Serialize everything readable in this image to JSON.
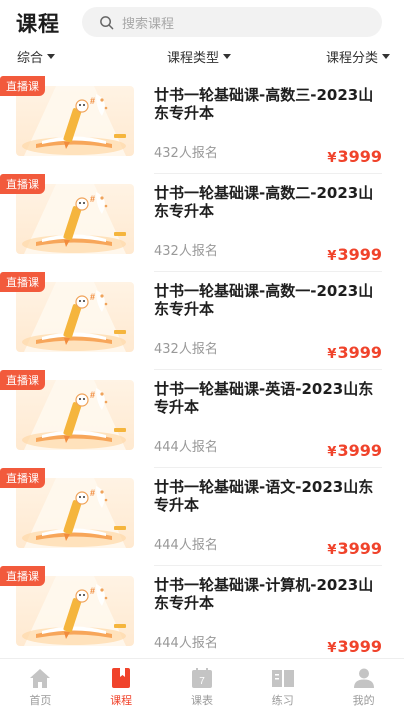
{
  "header": {
    "title": "课程",
    "search_placeholder": "搜索课程"
  },
  "filters": [
    {
      "label": "综合"
    },
    {
      "label": "课程类型"
    },
    {
      "label": "课程分类"
    }
  ],
  "courses": [
    {
      "tag": "直播课",
      "title": "廿书一轮基础课-高数三-2023山东专升本",
      "enrolled": "432人报名",
      "currency": "¥",
      "price": "3999"
    },
    {
      "tag": "直播课",
      "title": "廿书一轮基础课-高数二-2023山东专升本",
      "enrolled": "432人报名",
      "currency": "¥",
      "price": "3999"
    },
    {
      "tag": "直播课",
      "title": "廿书一轮基础课-高数一-2023山东专升本",
      "enrolled": "432人报名",
      "currency": "¥",
      "price": "3999"
    },
    {
      "tag": "直播课",
      "title": "廿书一轮基础课-英语-2023山东专升本",
      "enrolled": "444人报名",
      "currency": "¥",
      "price": "3999"
    },
    {
      "tag": "直播课",
      "title": "廿书一轮基础课-语文-2023山东专升本",
      "enrolled": "444人报名",
      "currency": "¥",
      "price": "3999"
    },
    {
      "tag": "直播课",
      "title": "廿书一轮基础课-计算机-2023山东专升本",
      "enrolled": "444人报名",
      "currency": "¥",
      "price": "3999"
    }
  ],
  "tabbar": [
    {
      "label": "首页",
      "icon": "home-icon",
      "active": false
    },
    {
      "label": "课程",
      "icon": "bookmark-book-icon",
      "active": true
    },
    {
      "label": "课表",
      "icon": "calendar-icon",
      "calendar_day": "7",
      "active": false
    },
    {
      "label": "练习",
      "icon": "open-book-icon",
      "active": false
    },
    {
      "label": "我的",
      "icon": "user-icon",
      "active": false
    }
  ],
  "colors": {
    "accent": "#f0432b",
    "tag": "#f25a3c",
    "inactive_tab": "#c4c4c4"
  }
}
